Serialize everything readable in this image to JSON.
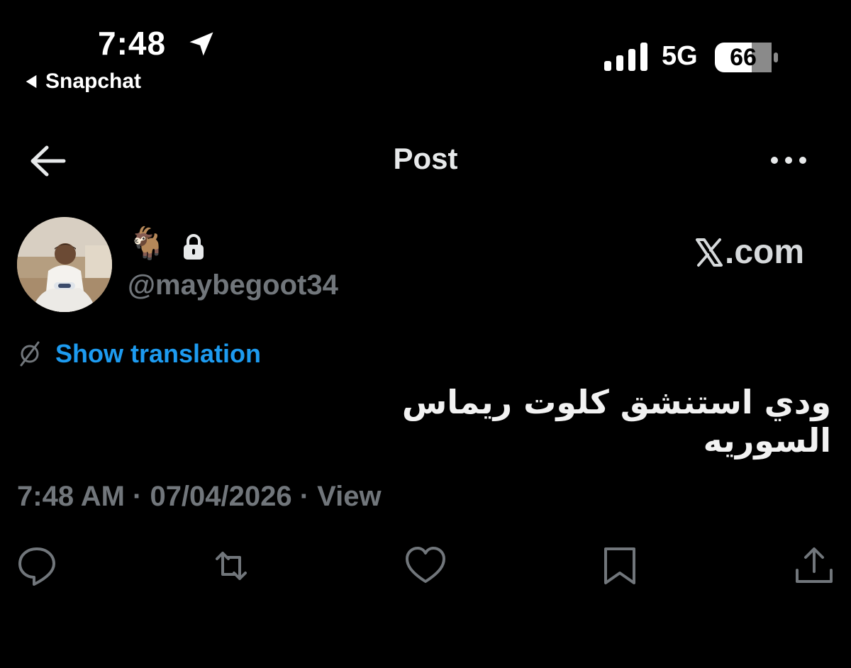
{
  "status_bar": {
    "time": "7:48",
    "back_app": "Snapchat",
    "network": "5G",
    "battery": "66"
  },
  "header": {
    "title": "Post"
  },
  "post": {
    "author_emoji": "🐐",
    "handle": "@maybegoot34",
    "source_domain": ".com",
    "show_translation_label": "Show translation",
    "text": "ودي استنشق كلوت ريماس السوريه",
    "meta": "7:48 AM · 07/04/2026 · View"
  },
  "icons": {
    "location": "location-arrow-icon",
    "signal": "cellular-signal-icon",
    "battery": "battery-icon",
    "back": "arrow-left-icon",
    "more": "more-horizontal-icon",
    "lock": "lock-icon",
    "translate": "globe-icon",
    "reply": "reply-icon",
    "retweet": "retweet-icon",
    "like": "heart-icon",
    "bookmark": "bookmark-icon",
    "share": "share-icon"
  },
  "colors": {
    "background": "#000000",
    "accent": "#1d9bf0",
    "secondary_text": "#71767b",
    "primary_text": "#e7e9ea"
  }
}
